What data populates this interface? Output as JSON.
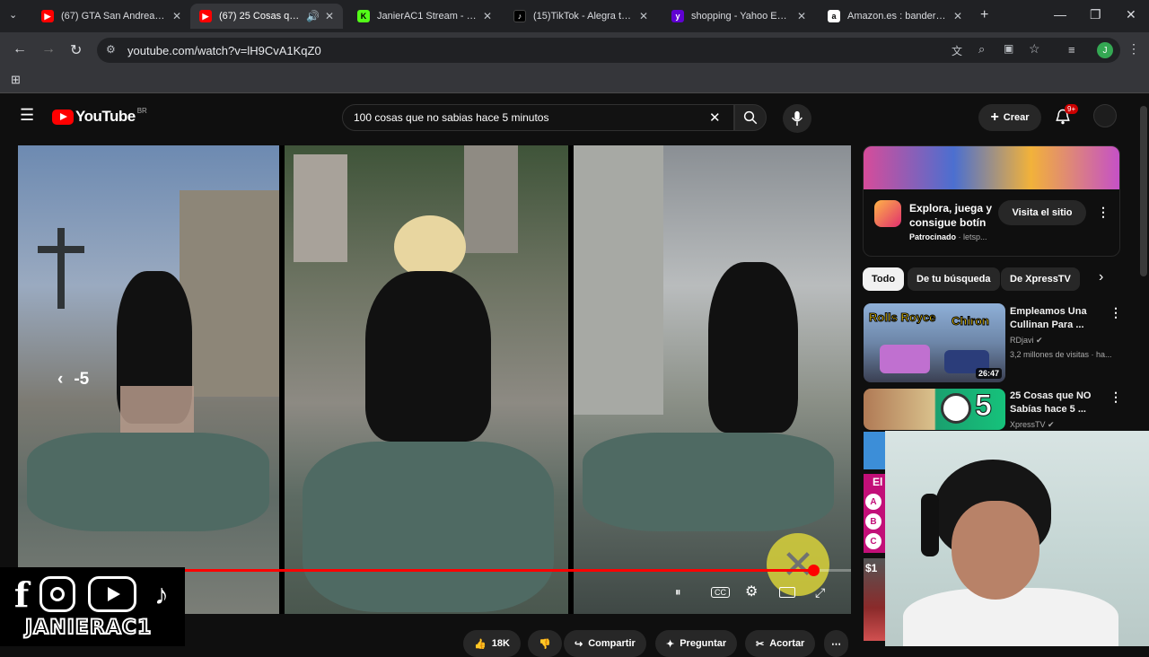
{
  "browser": {
    "tabs": [
      {
        "title": "(67) GTA San Andreas T",
        "favicon": "youtube-icon",
        "color": "#ff0000",
        "active": false
      },
      {
        "title": "(67) 25 Cosas que N",
        "favicon": "youtube-icon",
        "color": "#ff0000",
        "active": true
      },
      {
        "title": "JanierAC1 Stream - Wat",
        "favicon": "kick-icon",
        "color": "#53fc18",
        "active": false
      },
      {
        "title": "(15)TikTok - Alegra tu d",
        "favicon": "tiktok-icon",
        "color": "#000000",
        "active": false
      },
      {
        "title": "shopping - Yahoo Espa",
        "favicon": "yahoo-icon",
        "color": "#6001d2",
        "active": false
      },
      {
        "title": "Amazon.es : bandera p",
        "favicon": "amazon-icon",
        "color": "#ffffff",
        "active": false
      }
    ],
    "url": "youtube.com/watch?v=lH9CvA1KqZ0"
  },
  "header": {
    "logo_text": "YouTube",
    "country_code": "BR",
    "search_value": "100 cosas que no sabias hace 5 minutos",
    "create_label": "Crear",
    "notification_count": "9+"
  },
  "player": {
    "rewind_label": "-5",
    "progress": 0.955,
    "colors": {
      "progress": "#ff0000"
    }
  },
  "channel_overlay": {
    "name": "JANIERAC1"
  },
  "actions": {
    "likes": "18K",
    "share": "Compartir",
    "ask": "Preguntar",
    "clip": "Acortar"
  },
  "sidebar": {
    "ad": {
      "title": "Explora, juega y consigue botín",
      "sponsored": "Patrocinado",
      "domain": "letsp...",
      "cta": "Visita el sitio"
    },
    "chips": [
      "Todo",
      "De tu búsqueda",
      "De XpressTV"
    ],
    "recommendations": [
      {
        "title": "Empleamos Una Cullinan Para ...",
        "channel": "RDjavi",
        "meta": "3,2 millones de visitas · ha...",
        "duration": "26:47",
        "thumb_text_1": "Rolls Royce",
        "thumb_text_2": "Chiron"
      },
      {
        "title": "25 Cosas que NO Sabías hace 5 ...",
        "channel": "XpressTV",
        "thumb_number": "5"
      }
    ],
    "partial_thumbs": [
      "El",
      "A",
      "B",
      "C",
      "$1"
    ]
  }
}
